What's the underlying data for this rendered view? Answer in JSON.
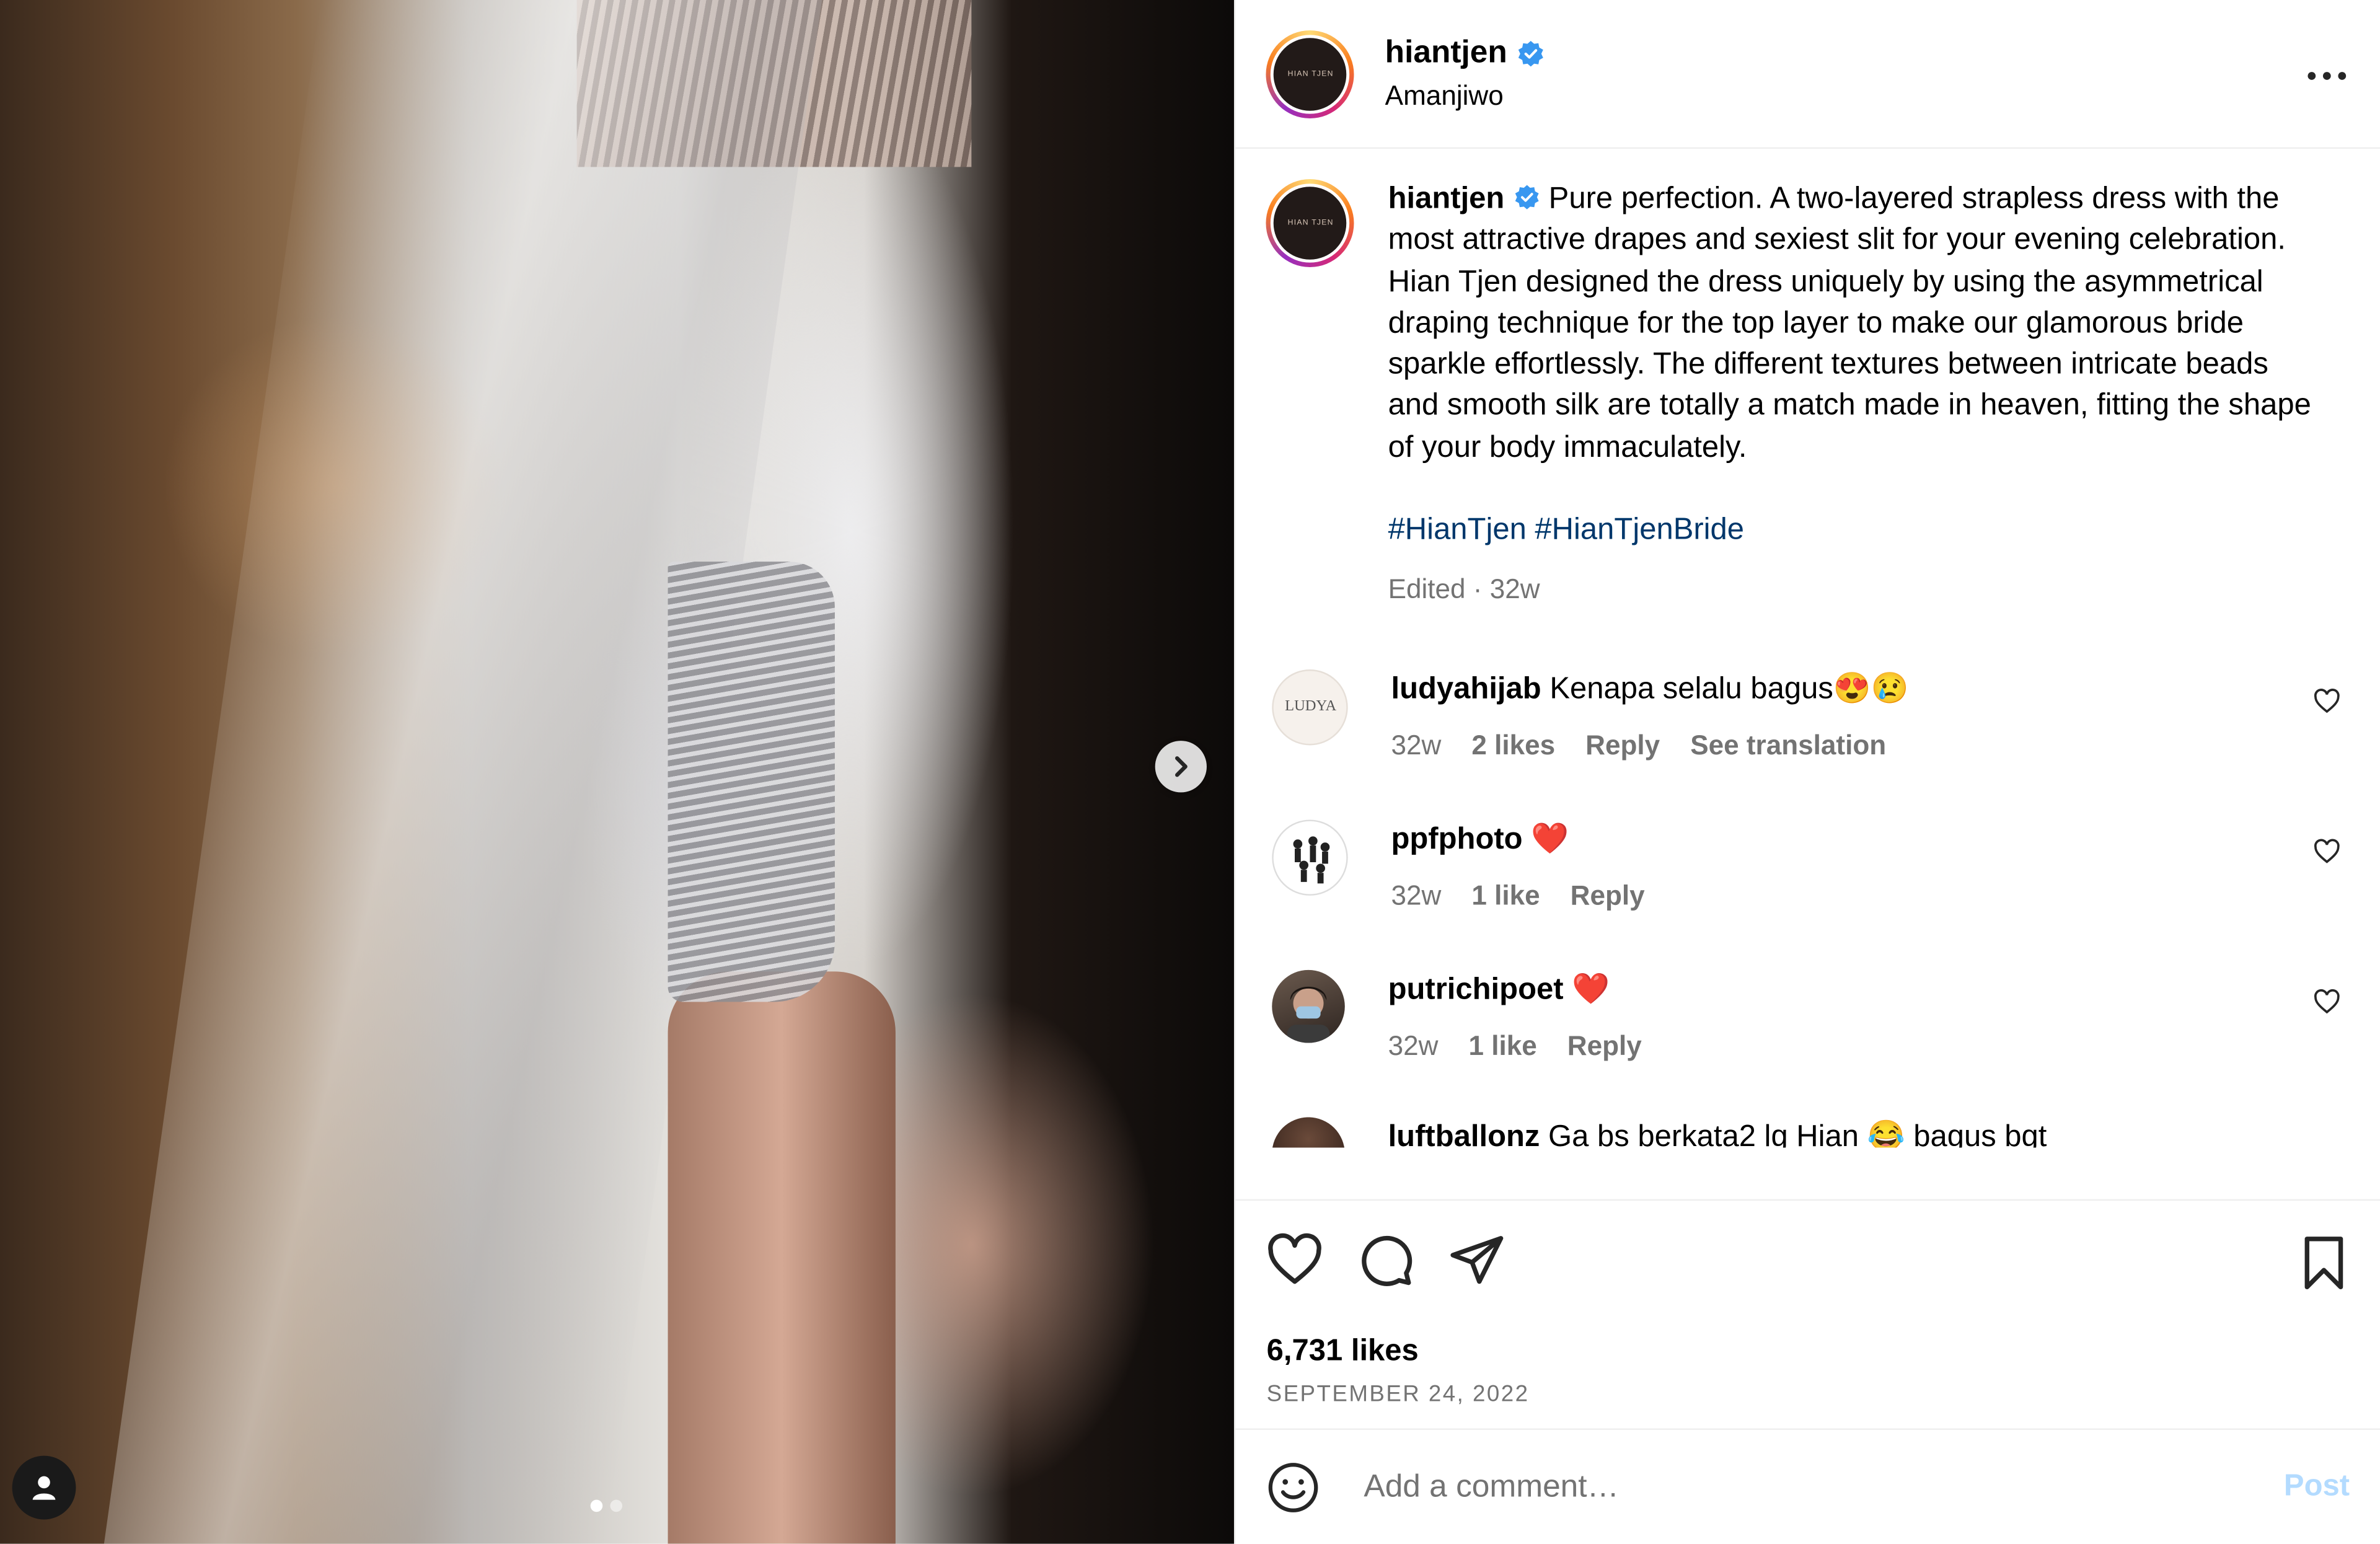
{
  "post": {
    "username": "hiantjen",
    "location": "Amanjiwo",
    "avatar_text": "HIAN TJEN",
    "caption": "Pure perfection. A two-layered strapless dress with the most attractive drapes and sexiest slit for your evening celebration. Hian Tjen designed the dress uniquely by using the asymmetrical draping technique for the top layer to make our glamorous bride sparkle effortlessly. The different textures between intricate beads and smooth silk are totally a match made in heaven, fitting the shape of your body immaculately.",
    "hashtags": "#HianTjen #HianTjenBride",
    "caption_meta": "Edited · 32w",
    "likes": "6,731 likes",
    "date": "SEPTEMBER 24, 2022"
  },
  "comments": [
    {
      "username": "ludyahijab",
      "text": "Kenapa selalu bagus😍😢",
      "avatar_text": "LUDYA",
      "time": "32w",
      "likes": "2 likes",
      "reply": "Reply",
      "translate": "See translation"
    },
    {
      "username": "ppfphoto",
      "text": "❤️",
      "time": "32w",
      "likes": "1 like",
      "reply": "Reply"
    },
    {
      "username": "putrichipoet",
      "text": "❤️",
      "time": "32w",
      "likes": "1 like",
      "reply": "Reply"
    },
    {
      "username": "luftballonz",
      "text": "Ga bs berkata2 lg Hian 😂 bagus bgt"
    }
  ],
  "composer": {
    "placeholder": "Add a comment…",
    "post_label": "Post"
  },
  "colors": {
    "verified": "#3897f0",
    "link": "#00376b",
    "muted": "#737373",
    "post_disabled": "#b3dbff"
  },
  "carousel": {
    "slides": 2,
    "active": 1
  }
}
